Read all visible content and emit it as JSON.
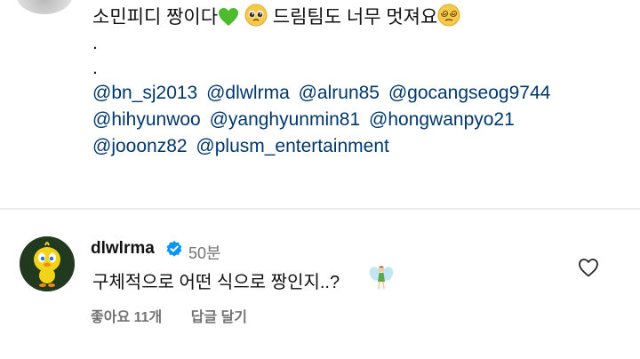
{
  "caption": {
    "line1_text": "소민피디 짱이다",
    "line1_text2": "드림팀도 너무 멋져요",
    "dot1": ".",
    "dot2": ".",
    "mentions": [
      "@bn_sj2013",
      "@dlwlrma",
      "@alrun85",
      "@gocangseog9744",
      "@hihyunwoo",
      "@yanghyunmin81",
      "@hongwanpyo21",
      "@jooonz82",
      "@plusm_entertainment"
    ]
  },
  "comment": {
    "username": "dlwlrma",
    "timestamp": "50분",
    "text": "구체적으로 어떤 식으로 짱인지..?",
    "likes": "좋아요 11개",
    "reply": "답글 달기"
  },
  "icons": {
    "green_heart": "green-heart-emoji",
    "pleading": "pleading-face-emoji",
    "dizzy": "face-with-spiral-eyes-emoji",
    "fairy": "fairy-emoji",
    "verified": "verified-badge-icon",
    "like": "heart-outline-icon"
  },
  "colors": {
    "mention": "#00376b",
    "verified": "#0095f6",
    "secondary_text": "#737373",
    "green_heart": "#4cbb2e"
  }
}
